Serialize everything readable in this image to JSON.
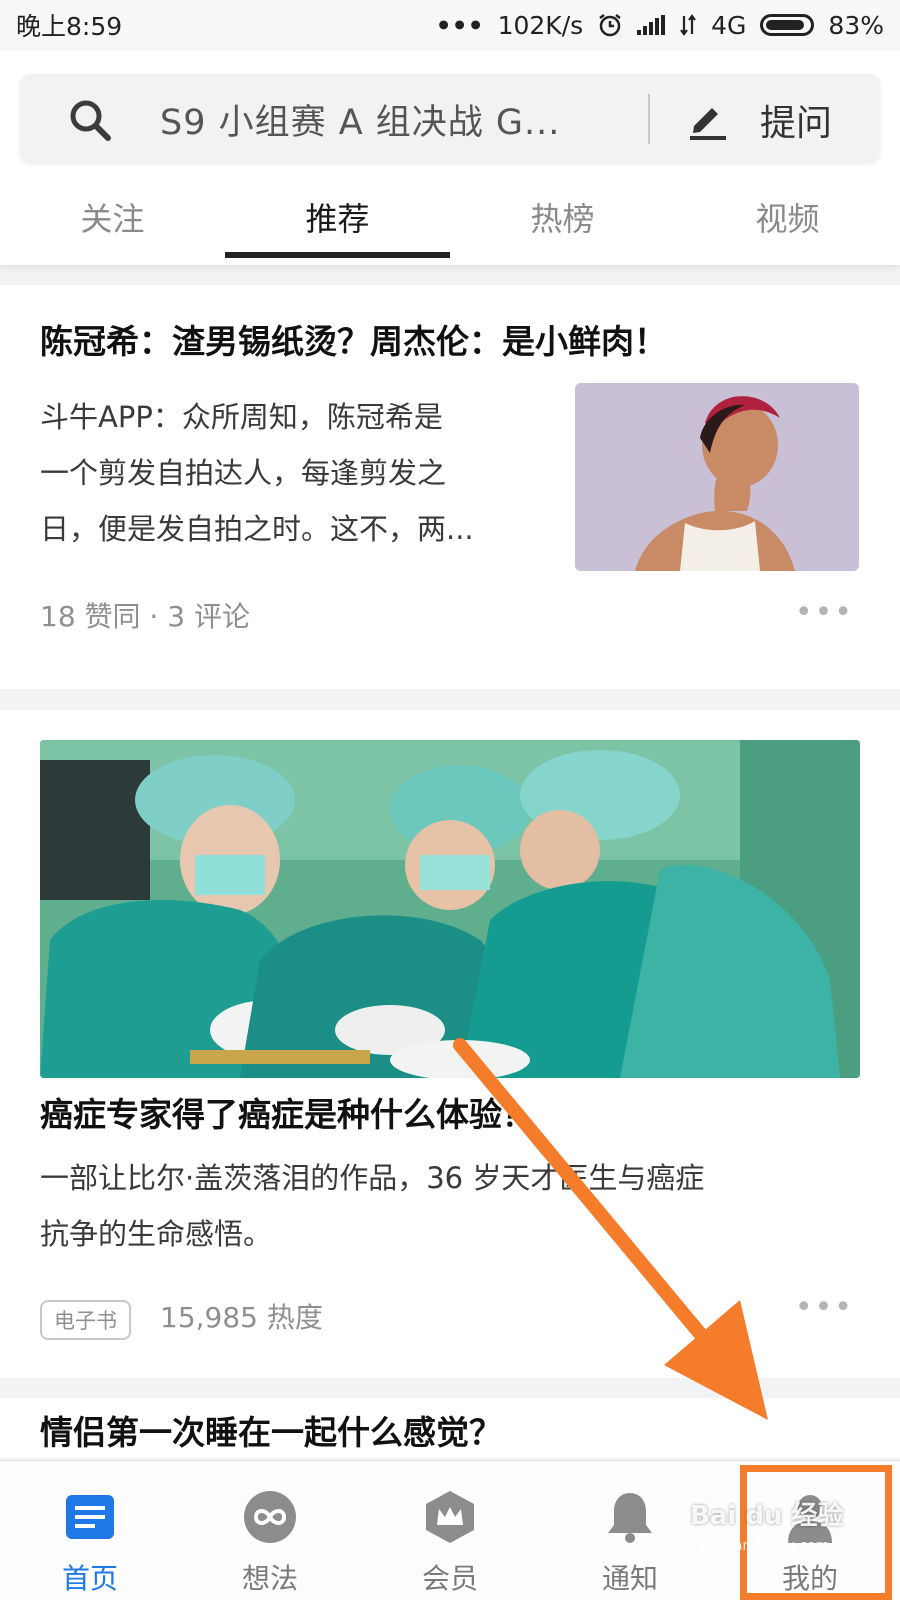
{
  "status_bar": {
    "time": "晚上8:59",
    "dots": "•••",
    "speed": "102K/s",
    "network": "4G",
    "battery": "83%"
  },
  "search": {
    "text": "S9 小组赛 A 组决战 G...",
    "ask_label": "提问"
  },
  "tabs": [
    {
      "label": "关注",
      "active": false
    },
    {
      "label": "推荐",
      "active": true
    },
    {
      "label": "热榜",
      "active": false
    },
    {
      "label": "视频",
      "active": false
    }
  ],
  "feed": [
    {
      "title": "陈冠希：渣男锡纸烫？周杰伦：是小鲜肉！",
      "excerpt_lines": [
        "斗牛APP：众所周知，陈冠希是",
        "一个剪发自拍达人，每逢剪发之",
        "日，便是发自拍之时。这不，两..."
      ],
      "meta": "18 赞同 · 3 评论"
    },
    {
      "title": "癌症专家得了癌症是种什么体验？",
      "excerpt_lines": [
        "一部让比尔·盖茨落泪的作品，36 岁天才医生与癌症",
        "抗争的生命感悟。"
      ],
      "tag": "电子书",
      "meta": "15,985 热度"
    },
    {
      "title": "情侣第一次睡在一起什么感觉？"
    }
  ],
  "more_label": "•••",
  "bottom_nav": [
    {
      "label": "首页",
      "icon": "home-doc-icon",
      "active": true
    },
    {
      "label": "想法",
      "icon": "thoughts-infinity-icon",
      "active": false
    },
    {
      "label": "会员",
      "icon": "membership-crown-icon",
      "active": false
    },
    {
      "label": "通知",
      "icon": "bell-icon",
      "active": false
    },
    {
      "label": "我的",
      "icon": "user-icon",
      "active": false
    }
  ],
  "watermark": {
    "text": "Bai du 经验",
    "sub": "jingyan.baidu.com"
  },
  "colors": {
    "accent_blue": "#1e78e6",
    "highlight_orange": "#f47c2a"
  }
}
